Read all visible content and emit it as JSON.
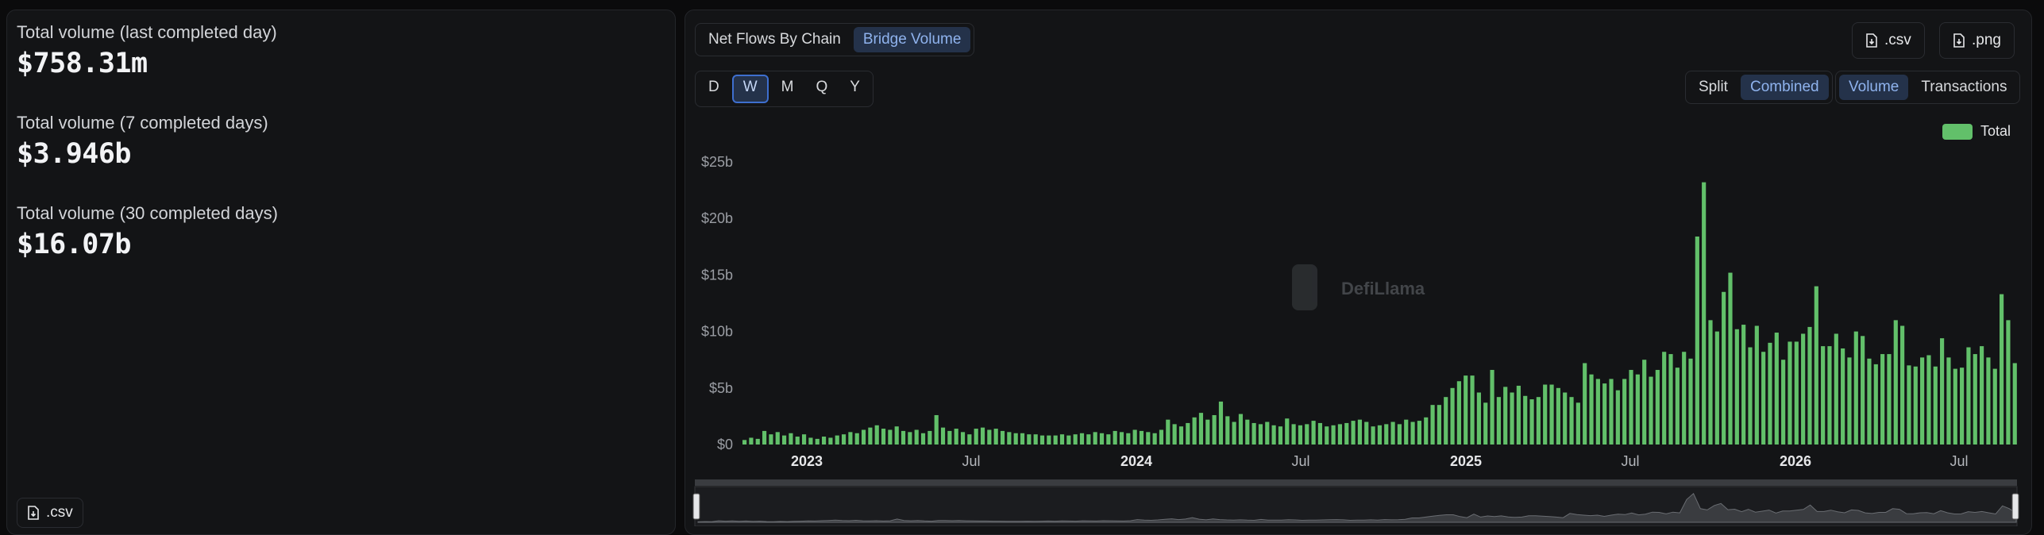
{
  "left": {
    "stats": [
      {
        "label": "Total volume (last completed day)",
        "value": "$758.31m"
      },
      {
        "label": "Total volume (7 completed days)",
        "value": "$3.946b"
      },
      {
        "label": "Total volume (30 completed days)",
        "value": "$16.07b"
      }
    ],
    "csv_label": ".csv"
  },
  "header": {
    "view_tabs": [
      "Net Flows By Chain",
      "Bridge Volume"
    ],
    "active_view": "Bridge Volume",
    "csv_label": ".csv",
    "png_label": ".png"
  },
  "controls": {
    "periods": [
      "D",
      "W",
      "M",
      "Q",
      "Y"
    ],
    "active_period": "W",
    "split_modes": [
      "Split",
      "Combined"
    ],
    "active_split": "Combined",
    "metrics": [
      "Volume",
      "Transactions"
    ],
    "active_metric": "Volume"
  },
  "watermark": "DefiLlama",
  "colors": {
    "accent": "#62c06a",
    "active_bg": "#24324a",
    "active_text": "#8fb3ee"
  },
  "chart_data": {
    "type": "bar",
    "series": [
      {
        "name": "Total"
      }
    ],
    "legend": "top-right",
    "ylim": [
      0,
      25
    ],
    "y_unit": "b",
    "yticks": [
      "$0",
      "$5b",
      "$10b",
      "$15b",
      "$20b",
      "$25b"
    ],
    "xticks": [
      {
        "label": "2023",
        "major": true
      },
      {
        "label": "Jul",
        "major": false
      },
      {
        "label": "2024",
        "major": true
      },
      {
        "label": "Jul",
        "major": false
      },
      {
        "label": "2025",
        "major": true
      },
      {
        "label": "Jul",
        "major": false
      },
      {
        "label": "2026",
        "major": true
      },
      {
        "label": "Jul",
        "major": false
      }
    ],
    "weekly_values": [
      0.4,
      0.6,
      0.5,
      1.2,
      0.9,
      1.1,
      0.8,
      1.0,
      0.7,
      0.9,
      0.6,
      0.5,
      0.7,
      0.6,
      0.8,
      0.9,
      1.1,
      1.0,
      1.3,
      1.5,
      1.7,
      1.4,
      1.3,
      1.6,
      1.2,
      1.1,
      1.3,
      1.0,
      1.2,
      2.6,
      1.5,
      1.2,
      1.4,
      1.1,
      0.9,
      1.4,
      1.5,
      1.3,
      1.4,
      1.2,
      1.1,
      1.0,
      1.0,
      0.9,
      0.9,
      0.8,
      0.8,
      0.8,
      0.9,
      0.8,
      0.9,
      1.0,
      0.9,
      1.1,
      1.0,
      0.9,
      1.2,
      1.1,
      1.0,
      1.3,
      1.2,
      1.1,
      1.0,
      1.3,
      2.2,
      1.8,
      1.6,
      1.9,
      2.4,
      2.8,
      2.2,
      2.6,
      3.8,
      2.5,
      2.0,
      2.7,
      2.2,
      1.9,
      1.8,
      2.0,
      1.7,
      1.6,
      2.3,
      1.8,
      1.7,
      1.8,
      2.1,
      1.9,
      1.6,
      1.7,
      1.8,
      1.9,
      2.1,
      2.2,
      2.0,
      1.6,
      1.7,
      1.8,
      2.0,
      1.8,
      2.2,
      2.0,
      2.1,
      2.4,
      3.5,
      3.5,
      4.2,
      5.0,
      5.6,
      6.1,
      6.1,
      4.6,
      3.7,
      6.6,
      4.2,
      5.1,
      4.6,
      5.2,
      4.3,
      4.0,
      4.2,
      5.3,
      5.3,
      5.0,
      4.6,
      4.2,
      3.7,
      7.2,
      6.2,
      5.8,
      5.4,
      5.8,
      4.8,
      5.8,
      6.6,
      6.2,
      7.5,
      6.0,
      6.6,
      8.2,
      8.0,
      6.8,
      8.2,
      7.6,
      18.4,
      23.2,
      11.0,
      10.0,
      13.5,
      15.2,
      10.2,
      10.6,
      8.6,
      10.5,
      8.2,
      9.0,
      9.9,
      7.5,
      9.1,
      9.1,
      9.8,
      10.4,
      14.0,
      8.7,
      8.7,
      9.8,
      8.5,
      7.7,
      10.0,
      9.6,
      7.6,
      7.1,
      8.0,
      8.0,
      11.0,
      10.5,
      7.0,
      6.9,
      7.7,
      7.9,
      6.9,
      9.4,
      7.7,
      6.7,
      6.8,
      8.6,
      8.0,
      8.7,
      7.7,
      6.7,
      13.3,
      11.0,
      7.2
    ]
  }
}
